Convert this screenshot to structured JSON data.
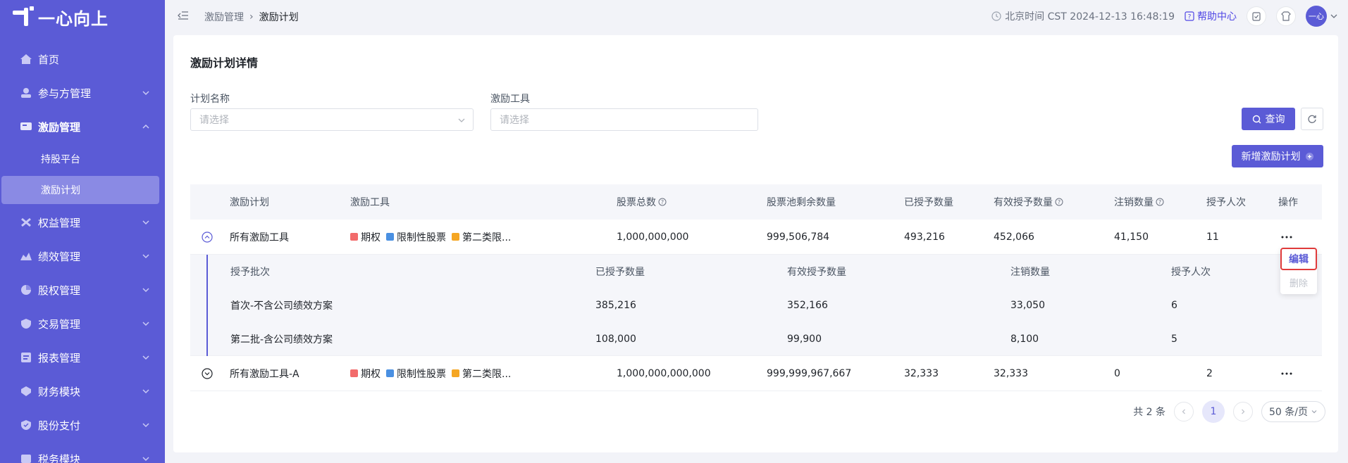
{
  "brand": {
    "name": "一心向上"
  },
  "sidebar": {
    "items": [
      {
        "label": "首页"
      },
      {
        "label": "参与方管理"
      },
      {
        "label": "激励管理"
      },
      {
        "label": "权益管理"
      },
      {
        "label": "绩效管理"
      },
      {
        "label": "股权管理"
      },
      {
        "label": "交易管理"
      },
      {
        "label": "报表管理"
      },
      {
        "label": "财务模块"
      },
      {
        "label": "股份支付"
      },
      {
        "label": "税务模块"
      }
    ],
    "sub_items": [
      {
        "label": "持股平台"
      },
      {
        "label": "激励计划"
      }
    ]
  },
  "header": {
    "breadcrumb": [
      "激励管理",
      "激励计划"
    ],
    "time_text": "北京时间 CST 2024-12-13 16:48:19",
    "help_label": "帮助中心",
    "avatar_text": "一心"
  },
  "page": {
    "title": "激励计划详情",
    "filters": {
      "plan_name_label": "计划名称",
      "plan_name_placeholder": "请选择",
      "tool_label": "激励工具",
      "tool_placeholder": "请选择"
    },
    "query_label": "查询",
    "add_label": "新增激励计划"
  },
  "table": {
    "headers": [
      "激励计划",
      "激励工具",
      "股票总数",
      "股票池剩余数量",
      "已授予数量",
      "有效授予数量",
      "注销数量",
      "授予人次",
      "操作"
    ],
    "tool_tags": [
      "期权",
      "限制性股票",
      "第二类限..."
    ],
    "rows": [
      {
        "plan": "所有激励工具",
        "total": "1,000,000,000",
        "remaining": "999,506,784",
        "granted": "493,216",
        "effective": "452,066",
        "cancelled": "41,150",
        "people": "11"
      },
      {
        "plan": "所有激励工具-A",
        "total": "1,000,000,000,000",
        "remaining": "999,999,967,667",
        "granted": "32,333",
        "effective": "32,333",
        "cancelled": "0",
        "people": "2"
      }
    ],
    "sub_headers": [
      "授予批次",
      "已授予数量",
      "有效授予数量",
      "注销数量",
      "授予人次"
    ],
    "sub_rows": [
      {
        "batch": "首次-不含公司绩效方案",
        "granted": "385,216",
        "effective": "352,166",
        "cancelled": "33,050",
        "people": "6"
      },
      {
        "batch": "第二批-含公司绩效方案",
        "granted": "108,000",
        "effective": "99,900",
        "cancelled": "8,100",
        "people": "5"
      }
    ]
  },
  "popover": {
    "edit_label": "编辑",
    "delete_label": "删除"
  },
  "pagination": {
    "total_text": "共 2 条",
    "current_page": "1",
    "page_size": "50 条/页"
  },
  "colors": {
    "primary": "#5b5bd6",
    "highlight_border": "#e03b3b"
  }
}
